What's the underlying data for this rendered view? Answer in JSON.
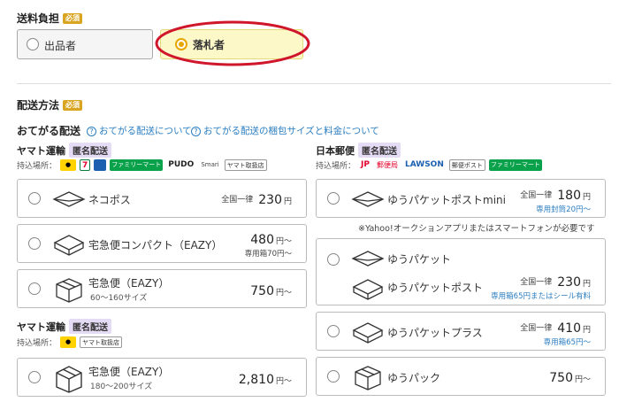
{
  "burden": {
    "title": "送料負担",
    "required": "必須",
    "options": [
      "出品者",
      "落札者"
    ],
    "selected": 1
  },
  "method": {
    "title": "配送方法",
    "required": "必須"
  },
  "otegaru": {
    "title": "おてがる配送",
    "link1": "おてがる配送について",
    "link2": "おてがる配送の梱包サイズと料金について"
  },
  "yamato1": {
    "carrier": "ヤマト運輸",
    "tag": "匿名配送",
    "drop_label": "持込場所：",
    "drop_logos": [
      "ヤマト運輸",
      "7",
      "ローソン",
      "ファミリーマート",
      "PUDO",
      "Smari",
      "ヤマト取扱店"
    ],
    "items": [
      {
        "name": "ネコポス",
        "prefix": "全国一律",
        "price": "230",
        "yen": "円",
        "note": ""
      },
      {
        "name": "宅急便コンパクト（EAZY）",
        "prefix": "",
        "price": "480",
        "yen": "円〜",
        "note": "専用箱70円〜"
      },
      {
        "name": "宅急便（EAZY）",
        "sub": "60〜160サイズ",
        "prefix": "",
        "price": "750",
        "yen": "円〜",
        "note": ""
      }
    ]
  },
  "yamato2": {
    "carrier": "ヤマト運輸",
    "tag": "匿名配送",
    "drop_label": "持込場所：",
    "drop_logos": [
      "ヤマト運輸",
      "ヤマト取扱店"
    ],
    "items": [
      {
        "name": "宅急便（EAZY）",
        "sub": "180〜200サイズ",
        "price": "2,810",
        "yen": "円〜"
      }
    ]
  },
  "japanpost": {
    "carrier": "日本郵便",
    "tag": "匿名配送",
    "drop_label": "持込場所：",
    "drop_logos": [
      "JP",
      "郵便局",
      "LAWSON",
      "郵便ポスト",
      "ファミリーマート"
    ],
    "mini": {
      "name": "ゆうパケットポストmini",
      "prefix": "全国一律",
      "price": "180",
      "yen": "円",
      "note": "専用封筒20円〜"
    },
    "app_note": "※Yahoo!オークションアプリまたはスマートフォンが必要です",
    "packet": {
      "name1": "ゆうパケット",
      "name2": "ゆうパケットポスト",
      "prefix": "全国一律",
      "price": "230",
      "yen": "円",
      "note": "専用箱65円またはシール有料"
    },
    "plus": {
      "name": "ゆうパケットプラス",
      "prefix": "全国一律",
      "price": "410",
      "yen": "円",
      "note": "専用箱65円〜"
    },
    "pack": {
      "name": "ゆうパック",
      "price": "750",
      "yen": "円〜"
    }
  },
  "colors": {
    "accent": "#e6a800",
    "link": "#2b7ec1",
    "highlight": "#fdf8c8",
    "ring": "#d0162a"
  }
}
